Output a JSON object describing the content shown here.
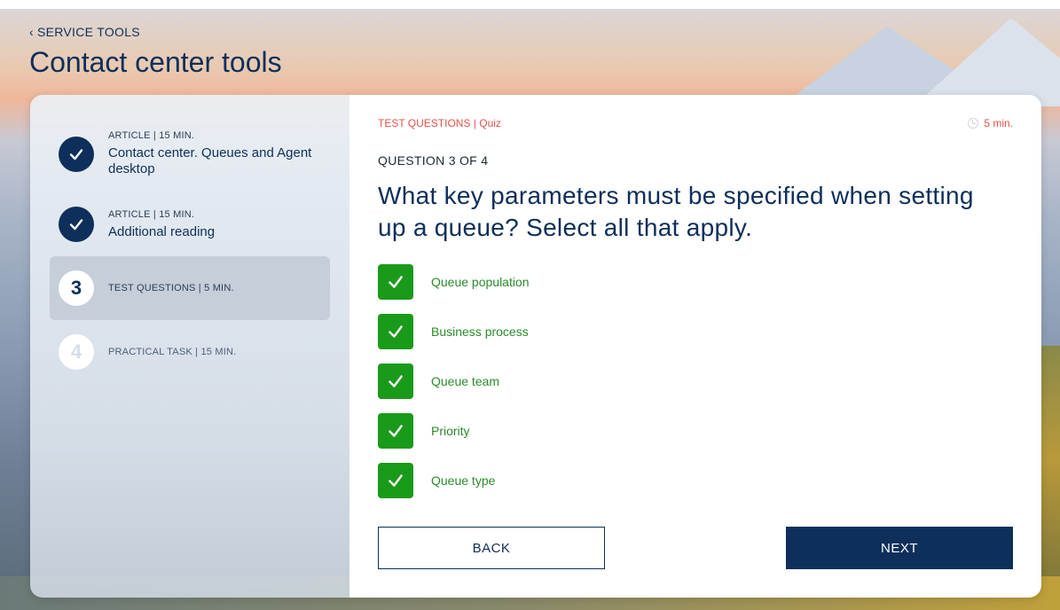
{
  "nav": {
    "back_label": "SERVICE TOOLS"
  },
  "page": {
    "title": "Contact center tools"
  },
  "sidebar": {
    "steps": [
      {
        "meta": "ARTICLE | 15 MIN.",
        "name": "Contact center. Queues and Agent desktop",
        "state": "done"
      },
      {
        "meta": "ARTICLE | 15 MIN.",
        "name": "Additional reading",
        "state": "done"
      },
      {
        "number": "3",
        "meta": "TEST QUESTIONS | 5 MIN.",
        "state": "current"
      },
      {
        "number": "4",
        "meta": "PRACTICAL TASK | 15 MIN.",
        "state": "todo"
      }
    ]
  },
  "quiz": {
    "breadcrumb": "TEST QUESTIONS | Quiz",
    "timer": "5 min.",
    "counter": "QUESTION 3 OF 4",
    "question": "What key parameters must be specified when setting up a queue? Select all that apply.",
    "options": [
      {
        "label": "Queue population",
        "checked": true
      },
      {
        "label": "Business process",
        "checked": true
      },
      {
        "label": "Queue team",
        "checked": true
      },
      {
        "label": "Priority",
        "checked": true
      },
      {
        "label": "Queue type",
        "checked": true
      }
    ],
    "back_label": "BACK",
    "next_label": "NEXT"
  },
  "colors": {
    "brand": "#0d2f5a",
    "accent": "#e0524a",
    "checked": "#1a9a1a"
  }
}
